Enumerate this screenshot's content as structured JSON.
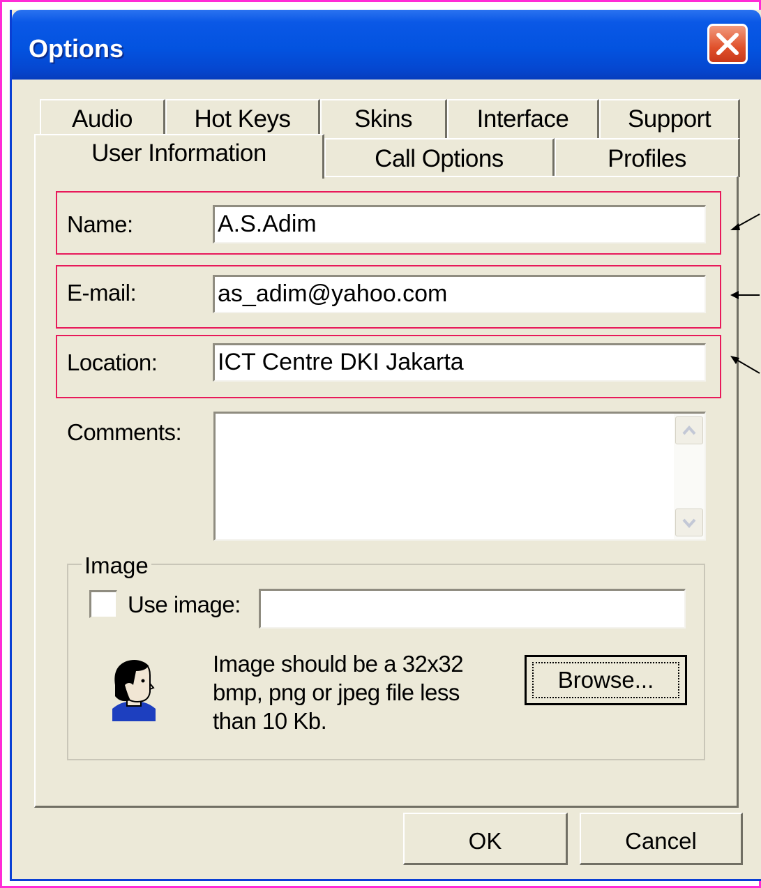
{
  "window": {
    "title": "Options"
  },
  "tabs": {
    "row1": [
      "Audio",
      "Hot Keys",
      "Skins",
      "Interface",
      "Support"
    ],
    "row2": [
      "User Information",
      "Call Options",
      "Profiles"
    ],
    "selected": "User Information"
  },
  "form": {
    "name_label": "Name:",
    "name_value": "A.S.Adim",
    "email_label": "E-mail:",
    "email_value": "as_adim@yahoo.com",
    "location_label": "Location:",
    "location_value": "ICT Centre DKI Jakarta",
    "comments_label": "Comments:",
    "comments_value": ""
  },
  "image_group": {
    "title": "Image",
    "use_image_label": "Use image:",
    "use_image_checked": false,
    "path_value": "",
    "info_line1": "Image should be a 32x32",
    "info_line2": "bmp, png or jpeg file less",
    "info_line3": "than 10 Kb.",
    "browse_label": "Browse..."
  },
  "buttons": {
    "ok_label": "OK",
    "cancel_label": "Cancel"
  },
  "colors": {
    "title_bar": "#0353e0",
    "highlight_box": "#e8195a",
    "frame": "#ff2bd6",
    "dialog_face": "#ece9d8"
  }
}
